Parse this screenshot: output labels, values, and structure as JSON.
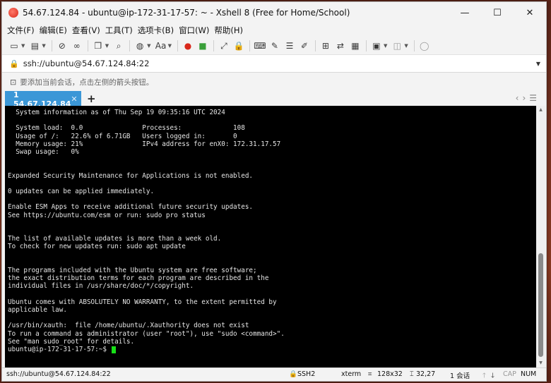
{
  "window": {
    "title": "54.67.124.84 - ubuntu@ip-172-31-17-57: ~ - Xshell 8 (Free for Home/School)",
    "controls": {
      "minimize": "—",
      "maximize": "☐",
      "close": "✕"
    }
  },
  "menu": [
    "文件(F)",
    "编辑(E)",
    "查看(V)",
    "工具(T)",
    "选项卡(B)",
    "窗口(W)",
    "帮助(H)"
  ],
  "address": {
    "value": "ssh://ubuntu@54.67.124.84:22"
  },
  "hint": {
    "text": "要添加当前会话，点击左侧的箭头按钮。"
  },
  "tabs": [
    {
      "label": "1 54.67.124.84",
      "status_color": "#3ad63a"
    }
  ],
  "terminal": {
    "lines": [
      "  System information as of Thu Sep 19 09:35:16 UTC 2024",
      "",
      "  System load:  0.0               Processes:             108",
      "  Usage of /:   22.6% of 6.71GB   Users logged in:       0",
      "  Memory usage: 21%               IPv4 address for enX0: 172.31.17.57",
      "  Swap usage:   0%",
      "",
      "",
      "Expanded Security Maintenance for Applications is not enabled.",
      "",
      "0 updates can be applied immediately.",
      "",
      "Enable ESM Apps to receive additional future security updates.",
      "See https://ubuntu.com/esm or run: sudo pro status",
      "",
      "",
      "The list of available updates is more than a week old.",
      "To check for new updates run: sudo apt update",
      "",
      "",
      "The programs included with the Ubuntu system are free software;",
      "the exact distribution terms for each program are described in the",
      "individual files in /usr/share/doc/*/copyright.",
      "",
      "Ubuntu comes with ABSOLUTELY NO WARRANTY, to the extent permitted by",
      "applicable law.",
      "",
      "/usr/bin/xauth:  file /home/ubuntu/.Xauthority does not exist",
      "To run a command as administrator (user \"root\"), use \"sudo <command>\".",
      "See \"man sudo_root\" for details.",
      ""
    ],
    "prompt": "ubuntu@ip-172-31-17-57:~$ ",
    "cursor_color": "#17e017"
  },
  "status": {
    "connection": "ssh://ubuntu@54.67.124.84:22",
    "protocol": "SSH2",
    "term_type": "xterm",
    "size": "128x32",
    "position": "32,27",
    "sessions": "1 会话",
    "caps": "CAP",
    "num": "NUM"
  }
}
